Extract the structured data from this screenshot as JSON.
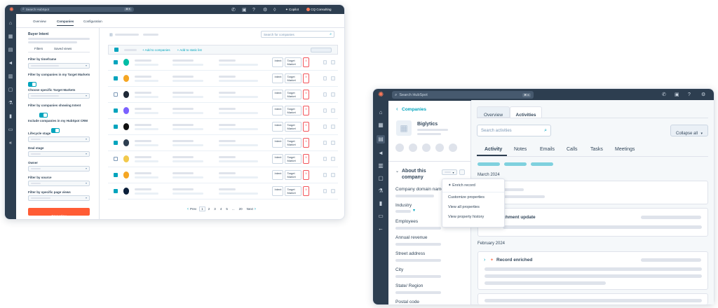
{
  "left_window": {
    "topbar": {
      "search_placeholder": "Search HubSpot",
      "kbd": "⌘ K",
      "copilot": "Copilot",
      "account": "CQ Consulting"
    },
    "tabs": [
      "Overview",
      "Companies",
      "Configuration"
    ],
    "panel": {
      "title": "Buyer Intent",
      "subtabs": [
        "Filters",
        "Saved views"
      ],
      "filters": [
        "Filter by timeframe",
        "Filter by companies in my Target Markets",
        "Choose specific Target Markets",
        "Filter by companies showing Intent",
        "Include companies in my HubSpot CRM",
        "Lifecycle stage",
        "Deal stage",
        "Owner",
        "Filter by source",
        "Filter by specific page views"
      ],
      "save_button": "Save View"
    },
    "table": {
      "search_placeholder": "Search for companies",
      "add_to_companies": "+ Add to companies",
      "add_to_static_list": "+ Add to static list",
      "tag_labels": [
        "Intent",
        "Target Market",
        "X"
      ],
      "row_logo_colors": [
        "#00bda5",
        "#f5a623",
        "#1f2937",
        "#7b61ff",
        "#111111",
        "#2d3e50",
        "#f2c94c",
        "#f5a623",
        "#0b1f3a"
      ],
      "row_checked": [
        true,
        true,
        false,
        true,
        true,
        true,
        false,
        true,
        true
      ]
    },
    "pagination": {
      "prev": "Prev",
      "pages": [
        "1",
        "2",
        "3",
        "4",
        "5"
      ],
      "ellipsis": "...",
      "last": "20",
      "next": "Next"
    }
  },
  "right_window": {
    "topbar": {
      "search_placeholder": "Search HubSpot",
      "kbd": "⌘ K"
    },
    "back_link": "Companies",
    "company_name": "Biglytics",
    "about_title": "About this company",
    "actions_menu": [
      "Enrich record",
      "Customize properties",
      "View all properties",
      "View property history"
    ],
    "properties": [
      "Company domain name",
      "Industry",
      "Employees",
      "Annual revenue",
      "Street address",
      "City",
      "State/ Region",
      "Postal code"
    ],
    "top_tabs": [
      "Overview",
      "Activities"
    ],
    "search_activities_placeholder": "Search activities",
    "collapse_all": "Collapse all",
    "activity_tabs": [
      "Activity",
      "Notes",
      "Emails",
      "Calls",
      "Tasks",
      "Meetings"
    ],
    "month_1": "March 2024",
    "enrichment_update": "Enrichment update",
    "enrichment_prefix": "...chment update",
    "month_2": "February 2024",
    "record_enriched": "Record enriched"
  },
  "colors": {
    "nav_dark": "#2d3e50",
    "accent_teal": "#00a4bd",
    "orange": "#ff5c35",
    "hubspot_orange": "#ff7a59"
  }
}
